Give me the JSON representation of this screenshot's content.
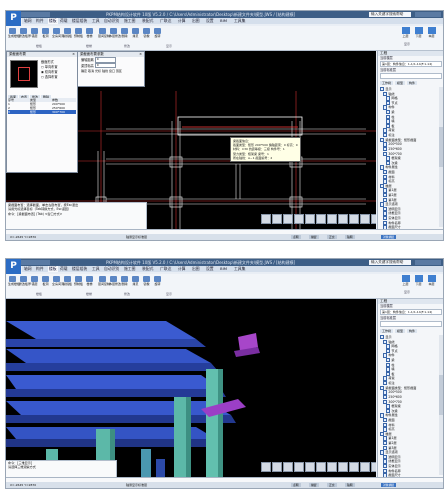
{
  "app": {
    "title": "PKPM结构设计软件 10版 V5.2.0 / C:\\Users\\Administrator\\Desktop\\新建文件夹\\模型.JWS / [结构建模]",
    "logo_text": "P",
    "search_placeholder": "输入关键字搜索帮助"
  },
  "menus": [
    "轴网",
    "构件",
    "楼板",
    "荷载",
    "楼层组装",
    "工具",
    "自动识别",
    "施工图",
    "装配式",
    "广联达",
    "计算",
    "出图",
    "设置",
    "BIM",
    "工具集"
  ],
  "active_menu": "楼板",
  "ribbon": {
    "buttons": [
      "生成楼板",
      "修改板厚",
      "错层",
      "板洞",
      "全房间洞",
      "悬挑板",
      "预制板",
      "楼梯",
      "层间复制",
      "本层修改",
      "删除",
      "拷贝",
      "镜像",
      "旋转"
    ],
    "groups": [
      "楼板",
      "楼梯",
      "修改",
      "显示"
    ],
    "right_buttons": [
      "上层",
      "下层",
      "本层"
    ],
    "right_label": "显示"
  },
  "shot1": {
    "dialog_section": {
      "title": "梁截面布置",
      "options": [
        "截面形式",
        "单向布置",
        "双向布置",
        "选择布置"
      ],
      "tabs": [
        "截面",
        "布置",
        "修改",
        "删除"
      ],
      "table_header": [
        "序号",
        "类型",
        "参数"
      ],
      "rows": [
        [
          "1",
          "矩形",
          "200*500"
        ],
        [
          "2",
          "矩形",
          "250*600"
        ],
        [
          "3",
          "矩形",
          "300*700"
        ]
      ],
      "selected_row": 2
    },
    "dialog_params": {
      "title": "梁截面布置参数",
      "row1_label": "偏轴距离",
      "row1_value": "0",
      "row2_label": "梁顶标高",
      "row2_value": "0",
      "buttons": [
        "确定",
        "取消",
        "光标",
        "轴线",
        "窗口",
        "围区"
      ]
    },
    "tooltip": [
      "梁截面信息：",
      "截面类型：矩形  200*500  偏轴距离：0  标高：0",
      "材料：C30  抗震等级：三级  构件号：1",
      "受力类型：框架梁  梁号：1",
      "所在轴线：A~1  截面编号：2"
    ],
    "info_lines": [
      "梁截面布置：选择截面，单击左键布置，按Esc退出",
      "请用光标选择目标（Tab转换方式，Esc返回）",
      "命令：[梁截面布置]  (Tab) <窗口方式>"
    ]
  },
  "shot2": {
    "info_lines": [
      "命令：[三维显示]",
      "请选择三维观察方式"
    ]
  },
  "right_panel": {
    "header": "工程",
    "sub1": "当前楼层",
    "input_value": "第1层：构件信息：1-1/1-14(F:1-14)",
    "sub2": "当前标准层",
    "tabs": [
      "工作树",
      "模型",
      "构件"
    ],
    "tree": [
      {
        "level": 0,
        "label": "显示"
      },
      {
        "level": 1,
        "label": "轴线"
      },
      {
        "level": 2,
        "label": "网格"
      },
      {
        "level": 2,
        "label": "节点"
      },
      {
        "level": 1,
        "label": "构件"
      },
      {
        "level": 2,
        "label": "梁"
      },
      {
        "level": 2,
        "label": "柱"
      },
      {
        "level": 2,
        "label": "墙"
      },
      {
        "level": 2,
        "label": "板"
      },
      {
        "level": 1,
        "label": "荷载"
      },
      {
        "level": 1,
        "label": "标注"
      },
      {
        "level": 0,
        "label": "梁截面类型：矩形截面"
      },
      {
        "level": 1,
        "label": "200*500"
      },
      {
        "level": 1,
        "label": "250*600"
      },
      {
        "level": 1,
        "label": "300*700"
      },
      {
        "level": 2,
        "label": "框架梁"
      },
      {
        "level": 2,
        "label": "次梁"
      },
      {
        "level": 0,
        "label": "构件属性"
      },
      {
        "level": 1,
        "label": "截面"
      },
      {
        "level": 1,
        "label": "材料"
      },
      {
        "level": 1,
        "label": "标高"
      },
      {
        "level": 0,
        "label": "楼层"
      },
      {
        "level": 1,
        "label": "第1层"
      },
      {
        "level": 1,
        "label": "第2层"
      },
      {
        "level": 1,
        "label": "第3层"
      },
      {
        "level": 0,
        "label": "显示选项"
      },
      {
        "level": 1,
        "label": "透明显示"
      },
      {
        "level": 1,
        "label": "线框显示"
      },
      {
        "level": 1,
        "label": "实体显示"
      },
      {
        "level": 1,
        "label": "构件名称"
      },
      {
        "level": 1,
        "label": "截面尺寸"
      }
    ]
  },
  "statusbar": {
    "coord": "X=-2645  Y=2870",
    "items": [
      "点网",
      "捕捉",
      "正交",
      "轴网",
      "对象捕捉"
    ],
    "mode": "轴测显示标准层",
    "active": "对象捕捉"
  },
  "colors": {
    "viewport_bg": "#000000",
    "beam_blue": "#2f4fc0",
    "column_teal": "#58b6a4",
    "beam_purple": "#9b3fc6",
    "axis_red": "#d03030"
  }
}
